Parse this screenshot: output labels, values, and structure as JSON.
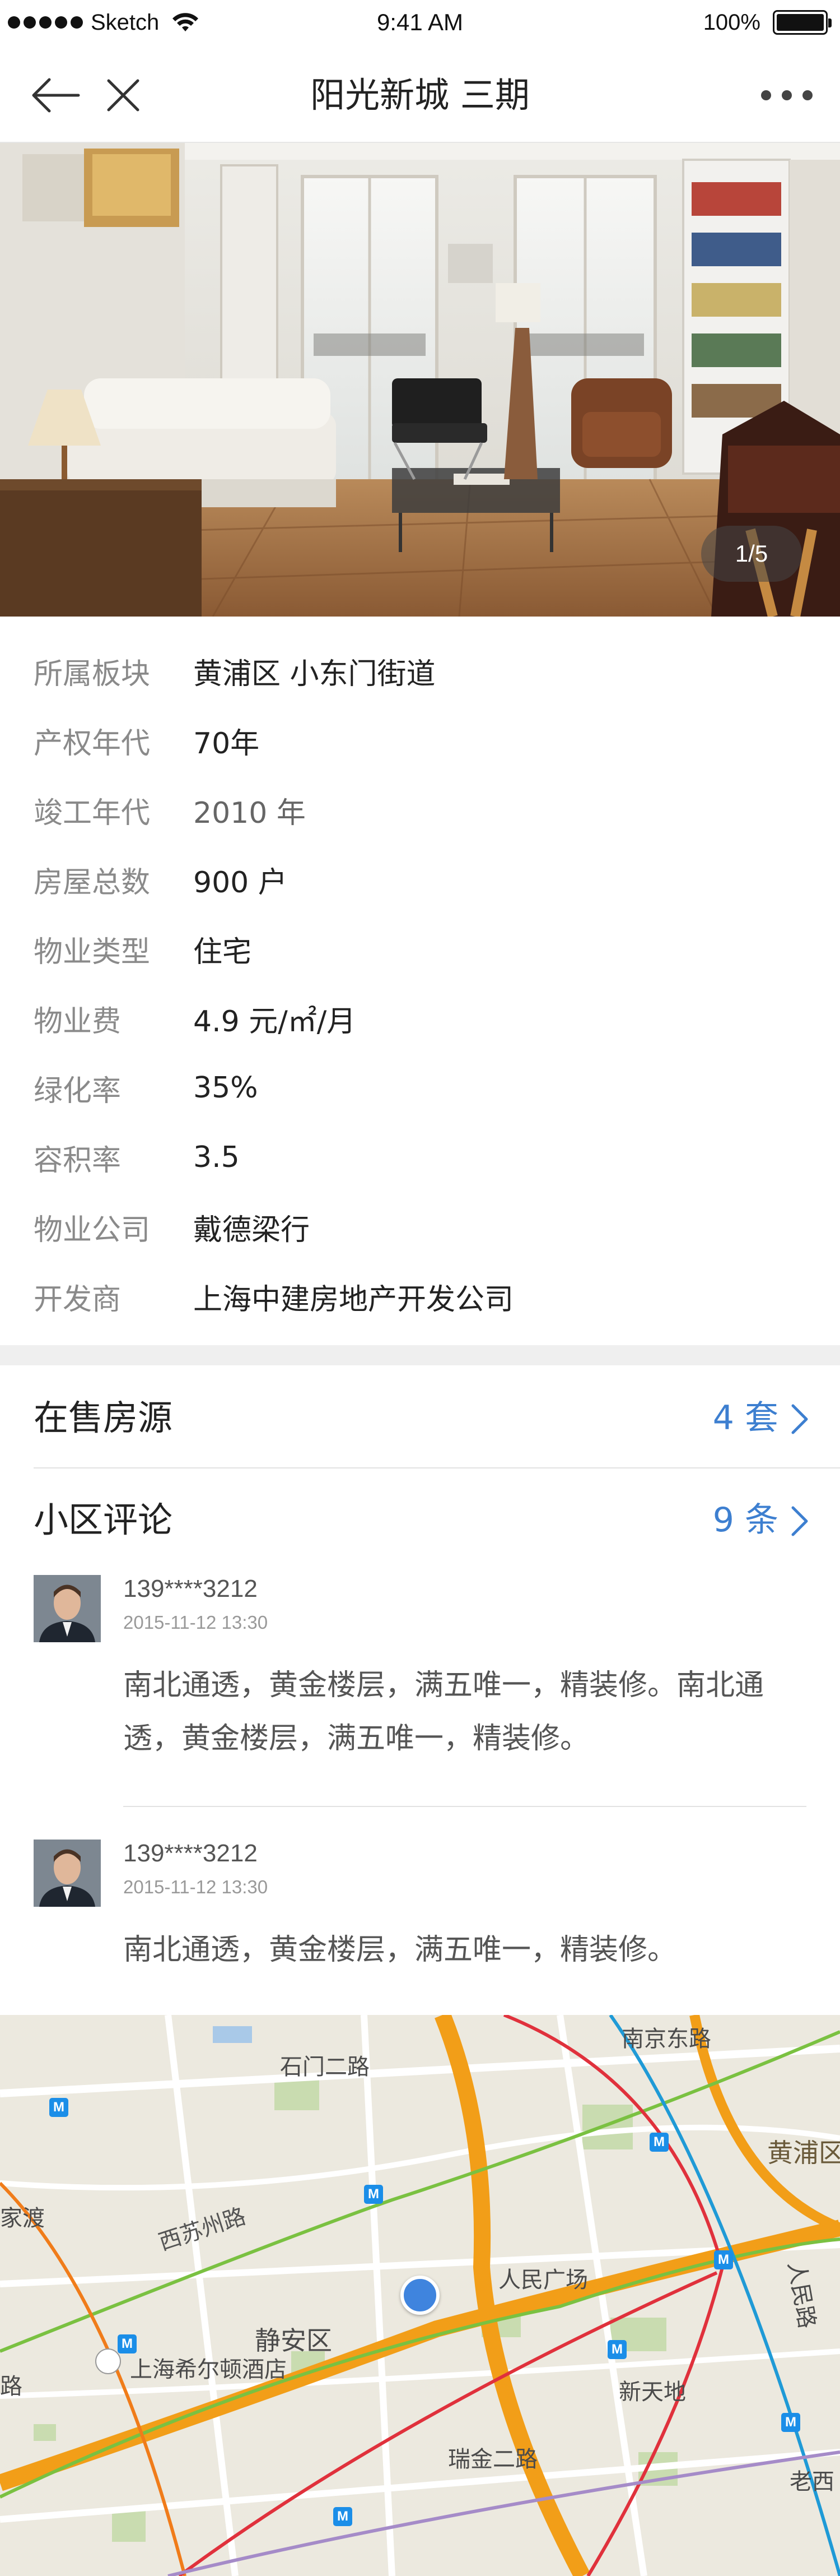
{
  "status_bar": {
    "carrier": "Sketch",
    "time": "9:41 AM",
    "battery": "100%"
  },
  "nav": {
    "title": "阳光新城 三期"
  },
  "gallery": {
    "counter": "1/5"
  },
  "info": [
    {
      "label": "所属板块",
      "value": "黄浦区 小东门街道"
    },
    {
      "label": "产权年代",
      "value": "70年"
    },
    {
      "label": "竣工年代",
      "value": "2010 年"
    },
    {
      "label": "房屋总数",
      "value": "900 户"
    },
    {
      "label": "物业类型",
      "value": "住宅"
    },
    {
      "label": "物业费",
      "value": "4.9 元/㎡/月"
    },
    {
      "label": "绿化率",
      "value": "35%"
    },
    {
      "label": "容积率",
      "value": "3.5"
    },
    {
      "label": "物业公司",
      "value": "戴德梁行"
    },
    {
      "label": "开发商",
      "value": "上海中建房地产开发公司"
    }
  ],
  "for_sale": {
    "title": "在售房源",
    "count": "4 套"
  },
  "reviews": {
    "title": "小区评论",
    "count": "9 条",
    "items": [
      {
        "user": "139****3212",
        "time": "2015-11-12  13:30",
        "text": "南北通透，黄金楼层，满五唯一，精装修。南北通透，黄金楼层，满五唯一，精装修。"
      },
      {
        "user": "139****3212",
        "time": "2015-11-12  13:30",
        "text": "南北通透，黄金楼层，满五唯一，精装修。"
      }
    ]
  },
  "map": {
    "labels": {
      "nanjing_east": "南京东路",
      "shimen": "石门二路",
      "huangpu": "黄浦区",
      "jiadu": "家渡",
      "xisuzhou": "西苏州路",
      "people_square": "人民广场",
      "peoples_road": "人民路",
      "jingan": "静安区",
      "lu": "路",
      "hilton": "上海希尔顿酒店",
      "xintiandi": "新天地",
      "ruijin": "瑞金二路",
      "laoxi": "老西"
    },
    "metro_symbol": "M"
  }
}
